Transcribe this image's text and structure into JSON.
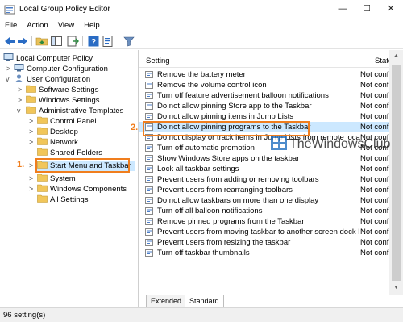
{
  "window": {
    "title": "Local Group Policy Editor",
    "minimize_label": "—",
    "maximize_label": "☐",
    "close_label": "✕"
  },
  "menubar": {
    "items": [
      "File",
      "Action",
      "View",
      "Help"
    ]
  },
  "toolbar": {
    "icons": [
      "back-arrow-icon",
      "forward-arrow-icon",
      "up-folder-icon",
      "show-hide-tree-icon",
      "export-list-icon",
      "help-icon",
      "properties-icon",
      "filter-icon"
    ]
  },
  "tree": {
    "items": [
      {
        "label": "Local Computer Policy",
        "icon": "computer-icon"
      },
      {
        "label": "Computer Configuration",
        "icon": "computer-icon",
        "chevron": ">"
      },
      {
        "label": "User Configuration",
        "icon": "user-icon",
        "chevron": "v"
      },
      {
        "label": "Software Settings",
        "icon": "folder-icon",
        "chevron": ">"
      },
      {
        "label": "Windows Settings",
        "icon": "folder-icon",
        "chevron": ">"
      },
      {
        "label": "Administrative Templates",
        "icon": "folder-icon",
        "chevron": "v"
      },
      {
        "label": "Control Panel",
        "icon": "folder-icon",
        "chevron": ">"
      },
      {
        "label": "Desktop",
        "icon": "folder-icon",
        "chevron": ">"
      },
      {
        "label": "Network",
        "icon": "folder-icon",
        "chevron": ">"
      },
      {
        "label": "Shared Folders",
        "icon": "folder-icon"
      },
      {
        "label": "Start Menu and Taskbar",
        "icon": "folder-icon",
        "chevron": ">",
        "selected": true
      },
      {
        "label": "System",
        "icon": "folder-icon",
        "chevron": ">"
      },
      {
        "label": "Windows Components",
        "icon": "folder-icon",
        "chevron": ">"
      },
      {
        "label": "All Settings",
        "icon": "folder-icon"
      }
    ]
  },
  "list": {
    "headers": {
      "setting": "Setting",
      "state": "State"
    },
    "rows": [
      {
        "name": "Remove the battery meter",
        "state": "Not confi"
      },
      {
        "name": "Remove the volume control icon",
        "state": "Not confi"
      },
      {
        "name": "Turn off feature advertisement balloon notifications",
        "state": "Not confi"
      },
      {
        "name": "Do not allow pinning Store app to the Taskbar",
        "state": "Not confi"
      },
      {
        "name": "Do not allow pinning items in Jump Lists",
        "state": "Not confi"
      },
      {
        "name": "Do not allow pinning programs to the Taskbar",
        "state": "Not confi",
        "selected": true
      },
      {
        "name": "Do not display or track items in Jump Lists from remote loca...",
        "state": "Not confi"
      },
      {
        "name": "Turn off automatic promotion",
        "state": "Not confi"
      },
      {
        "name": "Show Windows Store apps on the taskbar",
        "state": "Not confi"
      },
      {
        "name": "Lock all taskbar settings",
        "state": "Not confi"
      },
      {
        "name": "Prevent users from adding or removing toolbars",
        "state": "Not confi"
      },
      {
        "name": "Prevent users from rearranging toolbars",
        "state": "Not confi"
      },
      {
        "name": "Do not allow taskbars on more than one display",
        "state": "Not confi"
      },
      {
        "name": "Turn off all balloon notifications",
        "state": "Not confi"
      },
      {
        "name": "Remove pinned programs from the Taskbar",
        "state": "Not confi"
      },
      {
        "name": "Prevent users from moving taskbar to another screen dock l...",
        "state": "Not confi"
      },
      {
        "name": "Prevent users from resizing the taskbar",
        "state": "Not confi"
      },
      {
        "name": "Turn off taskbar thumbnails",
        "state": "Not confi"
      }
    ]
  },
  "tabs": [
    "Extended",
    "Standard"
  ],
  "status": {
    "text": "96 setting(s)"
  },
  "annotations": {
    "callout_1": "1.",
    "callout_2": "2."
  },
  "watermark": {
    "text": "TheWindowsClub"
  },
  "colors": {
    "highlight": "#f07e1e",
    "selection": "#cce8ff"
  }
}
